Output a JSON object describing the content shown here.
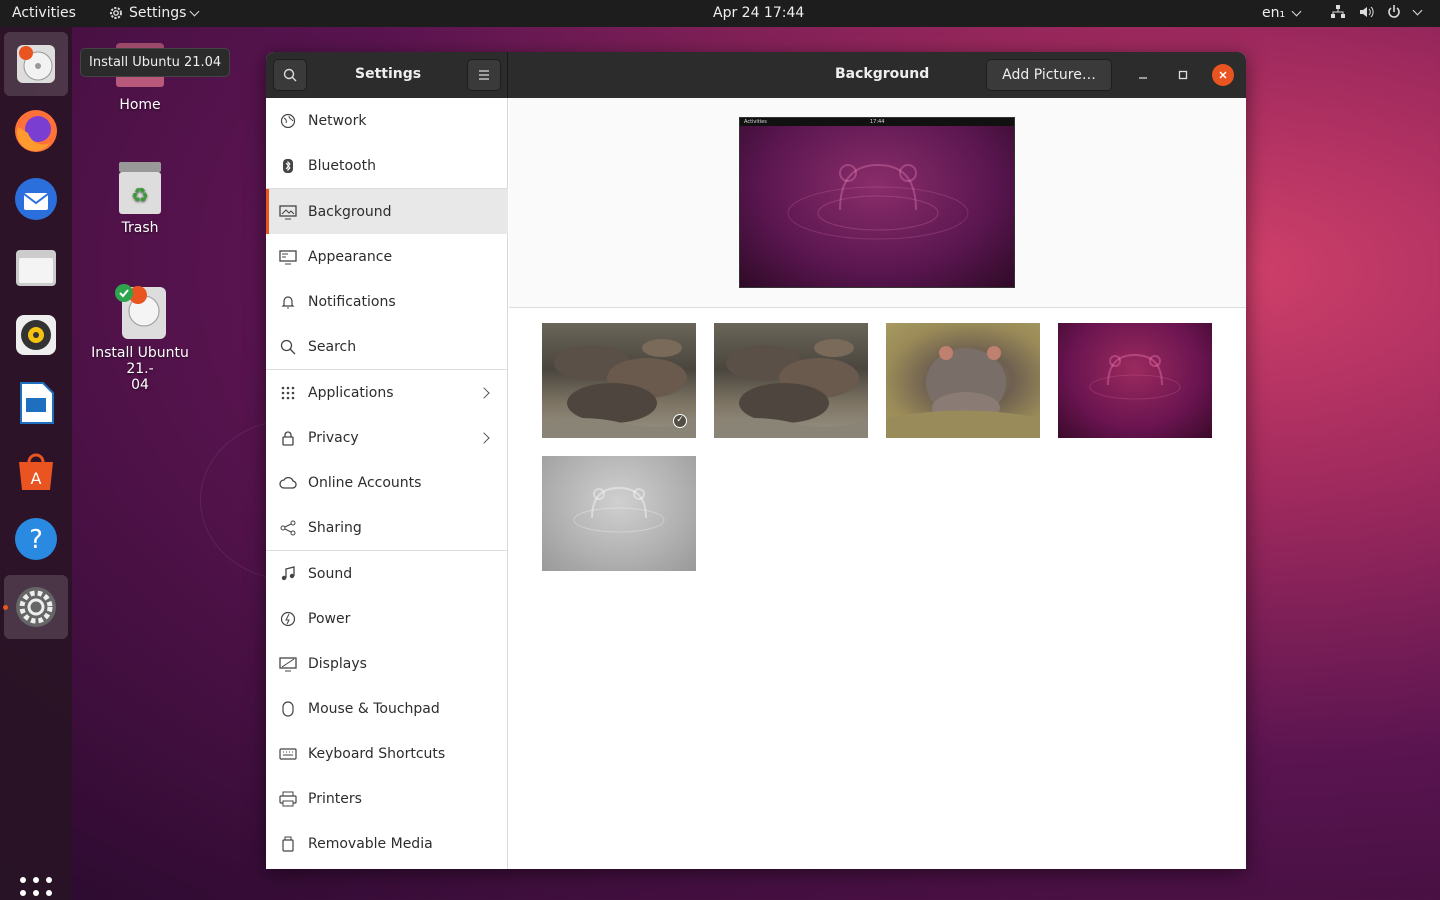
{
  "topbar": {
    "activities": "Activities",
    "app_menu": "Settings",
    "clock": "Apr 24  17:44",
    "lang": "en₁"
  },
  "tooltip": "Install Ubuntu 21.04",
  "desktop": {
    "home": "Home",
    "trash": "Trash",
    "install_line1": "Install Ubuntu 21.-",
    "install_line2": "04"
  },
  "window": {
    "sidebar_title": "Settings",
    "page_title": "Background",
    "add_picture": "Add Picture…"
  },
  "sidebar": {
    "items": [
      {
        "label": "Network",
        "icon": "network-icon"
      },
      {
        "label": "Bluetooth",
        "icon": "bluetooth-icon"
      },
      {
        "label": "Background",
        "icon": "background-icon",
        "selected": true
      },
      {
        "label": "Appearance",
        "icon": "appearance-icon"
      },
      {
        "label": "Notifications",
        "icon": "bell-icon"
      },
      {
        "label": "Search",
        "icon": "search-icon"
      },
      {
        "label": "Applications",
        "icon": "apps-icon",
        "arrow": true
      },
      {
        "label": "Privacy",
        "icon": "lock-icon",
        "arrow": true
      },
      {
        "label": "Online Accounts",
        "icon": "cloud-icon"
      },
      {
        "label": "Sharing",
        "icon": "share-icon"
      },
      {
        "label": "Sound",
        "icon": "music-note-icon"
      },
      {
        "label": "Power",
        "icon": "power-icon"
      },
      {
        "label": "Displays",
        "icon": "display-icon"
      },
      {
        "label": "Mouse & Touchpad",
        "icon": "mouse-icon"
      },
      {
        "label": "Keyboard Shortcuts",
        "icon": "keyboard-icon"
      },
      {
        "label": "Printers",
        "icon": "printer-icon"
      },
      {
        "label": "Removable Media",
        "icon": "usb-drive-icon"
      }
    ]
  },
  "preview": {
    "bar_left": "Activities",
    "bar_center": "17:44"
  },
  "colors": {
    "accent": "#e95420",
    "headerbar": "#2c2c2c",
    "topbar": "#1d1d1d"
  }
}
